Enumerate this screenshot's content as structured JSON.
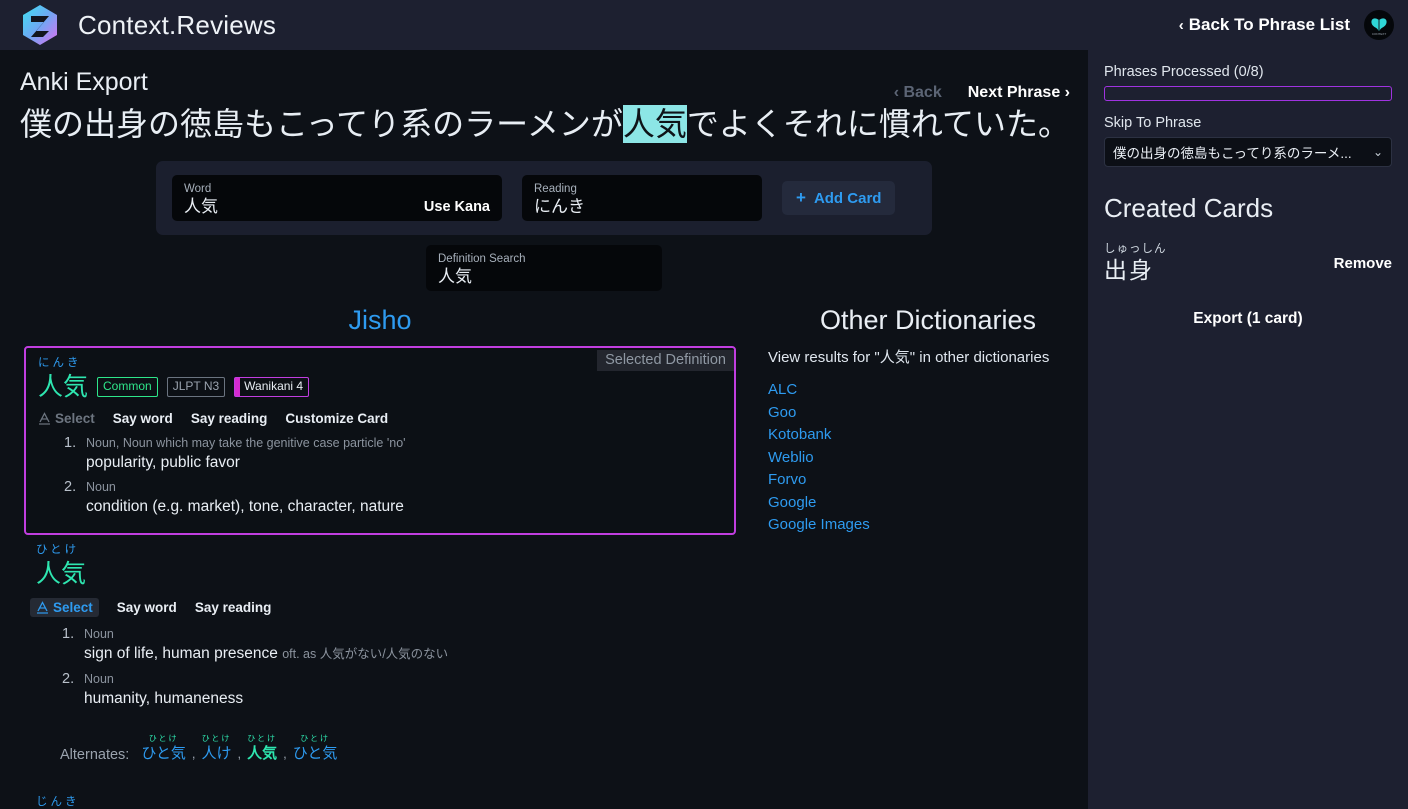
{
  "topbar": {
    "brand": "Context.Reviews",
    "back_to_list": "Back To Phrase List",
    "back_chevron": "‹",
    "logo_icon": "hexagon-z-logo",
    "avatar_icon": "butterfly-avatar"
  },
  "page": {
    "title": "Anki Export",
    "nav_back": "‹ Back",
    "nav_next": "Next Phrase ›",
    "phrase_before": "僕の出身の徳島もこってり系のラーメンが",
    "phrase_highlight": "人気",
    "phrase_after": "でよくそれに慣れていた。"
  },
  "form": {
    "word_label": "Word",
    "word_value": "人気",
    "use_kana": "Use Kana",
    "reading_label": "Reading",
    "reading_value": "にんき",
    "add_card": "Add Card",
    "add_card_plus": "+",
    "definition_search_label": "Definition Search",
    "definition_search_value": "人気"
  },
  "jisho": {
    "title": "Jisho",
    "selected_badge": "Selected Definition",
    "entries": [
      {
        "furigana": "にんき",
        "word": "人気",
        "tags": [
          "Common",
          "JLPT N3",
          "Wanikani 4"
        ],
        "actions": [
          "Select",
          "Say word",
          "Say reading",
          "Customize Card"
        ],
        "senses": [
          {
            "num": "1.",
            "pos": "Noun, Noun which may take the genitive case particle 'no'",
            "gloss": "popularity, public favor",
            "note": ""
          },
          {
            "num": "2.",
            "pos": "Noun",
            "gloss": "condition (e.g. market), tone, character, nature",
            "note": ""
          }
        ]
      },
      {
        "furigana": "ひとけ",
        "word": "人気",
        "tags": [],
        "actions": [
          "Select",
          "Say word",
          "Say reading"
        ],
        "senses": [
          {
            "num": "1.",
            "pos": "Noun",
            "gloss": "sign of life, human presence",
            "note": "oft. as 人気がない/人気のない"
          },
          {
            "num": "2.",
            "pos": "Noun",
            "gloss": "humanity, humaneness",
            "note": ""
          }
        ],
        "alternates_label": "Alternates:",
        "alternates": [
          {
            "furigana": "ひとけ",
            "word": "ひと気",
            "highlight": false
          },
          {
            "furigana": "ひとけ",
            "word": "人け",
            "highlight": false
          },
          {
            "furigana": "ひとけ",
            "word": "人気",
            "highlight": true
          },
          {
            "furigana": "ひとけ",
            "word": "ひと気",
            "highlight": false
          }
        ]
      }
    ],
    "tail_furigana": "じんき"
  },
  "other_dicts": {
    "title": "Other Dictionaries",
    "subtitle": "View results for \"人気\" in other dictionaries",
    "links": [
      "ALC",
      "Goo",
      "Kotobank",
      "Weblio",
      "Forvo",
      "Google",
      "Google Images"
    ]
  },
  "sidebar": {
    "progress_label": "Phrases Processed (0/8)",
    "progress_percent": 0,
    "skip_label": "Skip To Phrase",
    "skip_value": "僕の出身の徳島もこってり系のラーメ...",
    "caret": "⌄",
    "cards_title": "Created Cards",
    "cards": [
      {
        "furigana": "しゅっしん",
        "word": "出身",
        "remove": "Remove"
      }
    ],
    "export": "Export (1 card)"
  },
  "colors": {
    "accent_blue": "#2e9bf0",
    "accent_green": "#2ee6b0",
    "accent_purple": "#c13ee0",
    "highlight_cyan": "#8ce6e6",
    "bg": "#0d1117",
    "panel": "#1d2030"
  }
}
